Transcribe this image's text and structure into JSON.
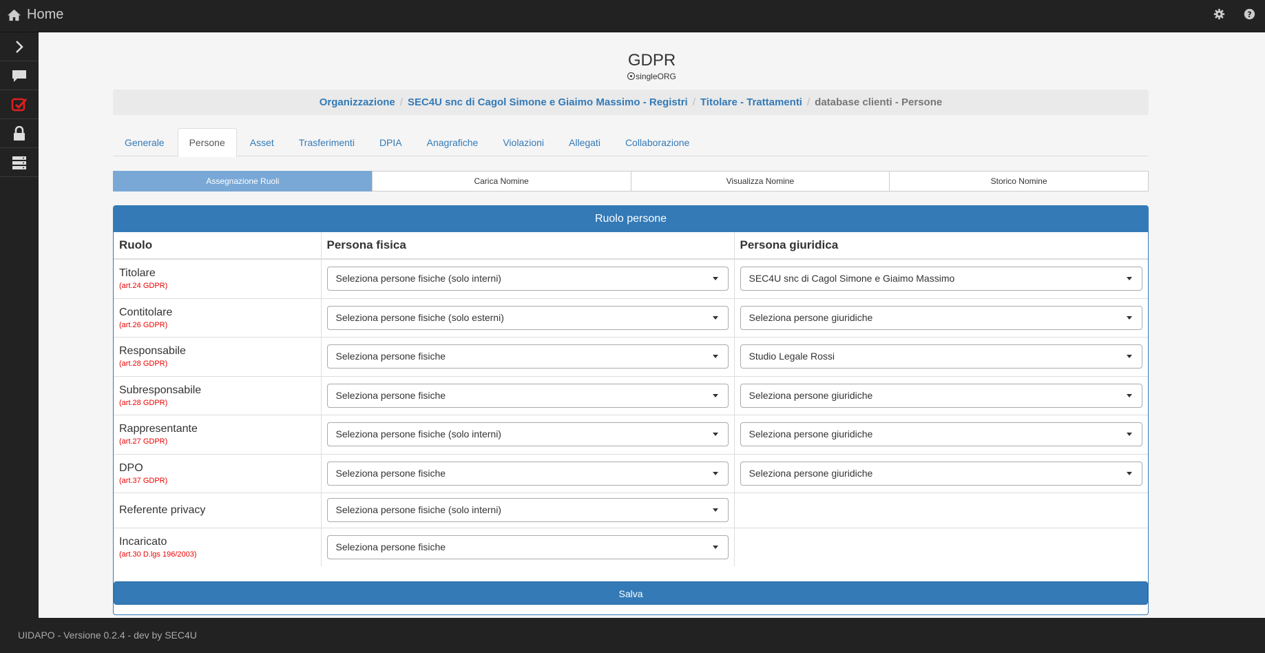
{
  "topbar": {
    "home_label": "Home"
  },
  "page": {
    "title": "GDPR",
    "subtitle": "singleORG"
  },
  "breadcrumb": {
    "items": [
      "Organizzazione",
      "SEC4U snc di Cagol Simone e Giaimo Massimo - Registri",
      "Titolare - Trattamenti"
    ],
    "active": "database clienti - Persone"
  },
  "tabs": [
    "Generale",
    "Persone",
    "Asset",
    "Trasferimenti",
    "DPIA",
    "Anagrafiche",
    "Violazioni",
    "Allegati",
    "Collaborazione"
  ],
  "active_tab": "Persone",
  "subtabs": [
    "Assegnazione Ruoli",
    "Carica Nomine",
    "Visualizza Nomine",
    "Storico Nomine"
  ],
  "panel": {
    "title": "Ruolo persone",
    "headers": {
      "role": "Ruolo",
      "physical": "Persona fisica",
      "legal": "Persona giuridica"
    },
    "rows": [
      {
        "role": "Titolare",
        "ref": "(art.24 GDPR)",
        "physical": "Seleziona persone fisiche (solo interni)",
        "legal": "SEC4U snc di Cagol Simone e Giaimo Massimo"
      },
      {
        "role": "Contitolare",
        "ref": "(art.26 GDPR)",
        "physical": "Seleziona persone fisiche (solo esterni)",
        "legal": "Seleziona persone giuridiche"
      },
      {
        "role": "Responsabile",
        "ref": "(art.28 GDPR)",
        "physical": "Seleziona persone fisiche",
        "legal": "Studio Legale Rossi"
      },
      {
        "role": "Subresponsabile",
        "ref": "(art.28 GDPR)",
        "physical": "Seleziona persone fisiche",
        "legal": "Seleziona persone giuridiche"
      },
      {
        "role": "Rappresentante",
        "ref": "(art.27 GDPR)",
        "physical": "Seleziona persone fisiche (solo interni)",
        "legal": "Seleziona persone giuridiche"
      },
      {
        "role": "DPO",
        "ref": "(art.37 GDPR)",
        "physical": "Seleziona persone fisiche",
        "legal": "Seleziona persone giuridiche"
      },
      {
        "role": "Referente privacy",
        "ref": "",
        "physical": "Seleziona persone fisiche (solo interni)",
        "legal": ""
      },
      {
        "role": "Incaricato",
        "ref": "(art.30 D.lgs 196/2003)",
        "physical": "Seleziona persone fisiche",
        "legal": ""
      }
    ],
    "save_label": "Salva"
  },
  "footer": {
    "text": "UIDAPO - Versione 0.2.4 - dev by SEC4U"
  },
  "colors": {
    "primary": "#337ab7",
    "dark": "#222222",
    "accent_red": "#e02020"
  }
}
